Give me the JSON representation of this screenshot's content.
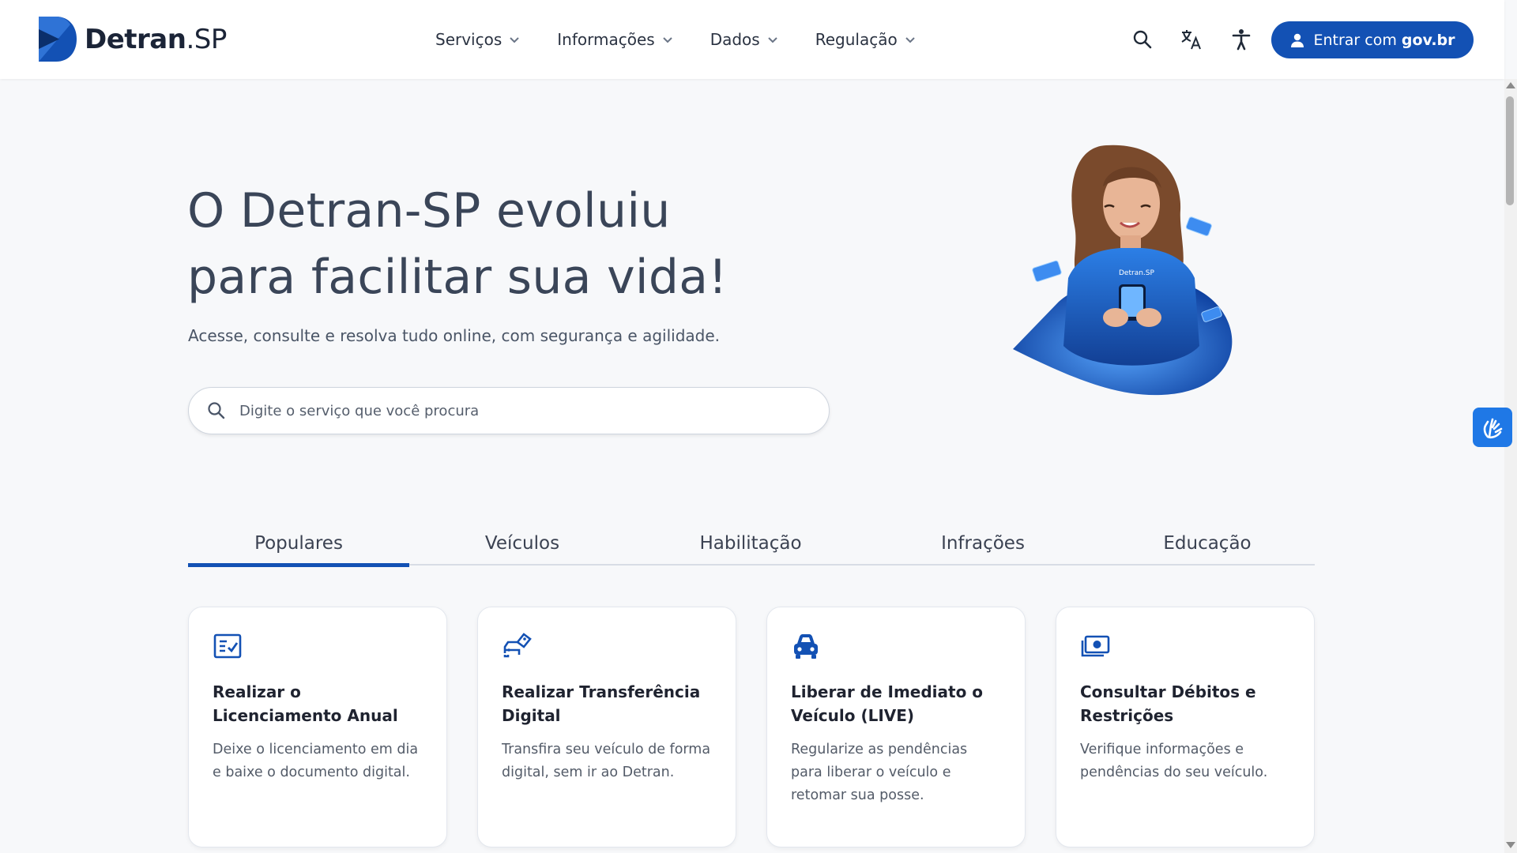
{
  "brand": {
    "name_bold": "Detran",
    "name_suffix": ".SP"
  },
  "nav": [
    {
      "label": "Serviços"
    },
    {
      "label": "Informações"
    },
    {
      "label": "Dados"
    },
    {
      "label": "Regulação"
    }
  ],
  "header": {
    "icons": [
      "search-icon",
      "translate-icon",
      "accessibility-icon"
    ],
    "login": {
      "label": "Entrar com",
      "label_bold": "gov.br"
    }
  },
  "hero": {
    "title_line1": "O Detran-SP evoluiu",
    "title_line2": "para facilitar sua vida!",
    "subtitle": "Acesse, consulte e resolva tudo online, com segurança e agilidade.",
    "search_placeholder": "Digite o serviço que você procura",
    "shirt_logo": "Detran.SP"
  },
  "tabs": [
    {
      "label": "Populares",
      "active": true
    },
    {
      "label": "Veículos",
      "active": false
    },
    {
      "label": "Habilitação",
      "active": false
    },
    {
      "label": "Infrações",
      "active": false
    },
    {
      "label": "Educação",
      "active": false
    }
  ],
  "cards": [
    {
      "icon": "checklist-icon",
      "title": "Realizar o Licenciamento Anual",
      "description": "Deixe o licenciamento em dia e baixe o documento digital."
    },
    {
      "icon": "car-transfer-icon",
      "title": "Realizar Transferência Digital",
      "description": "Transfira seu veículo de forma digital, sem ir ao Detran."
    },
    {
      "icon": "car-icon",
      "title": "Liberar de Imediato o Veículo (LIVE)",
      "description": "Regularize as pendências para liberar o veículo e retomar sua posse."
    },
    {
      "icon": "money-icon",
      "title": "Consultar Débitos e Restrições",
      "description": "Verifique informações e pendências do seu veículo."
    }
  ],
  "colors": {
    "primary": "#1351b4",
    "text": "#3a4558",
    "vlibras": "#1f78e6"
  }
}
